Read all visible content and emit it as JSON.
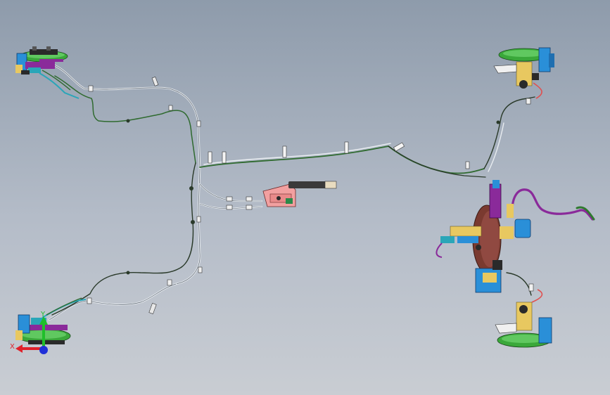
{
  "view": {
    "background_top": "#8e9bab",
    "background_bottom": "#c9cdd3"
  },
  "triad": {
    "x_label": "X",
    "y_label": "Y",
    "x_color": "#e0202a",
    "y_color": "#1fbf2a",
    "z_color": "#2030d8"
  },
  "assemblies": [
    {
      "name": "front-left-brake-corner",
      "part": "brake-disc-caliper"
    },
    {
      "name": "rear-left-brake-corner",
      "part": "brake-disc-caliper"
    },
    {
      "name": "front-right-brake-corner",
      "part": "brake-disc-caliper"
    },
    {
      "name": "rear-right-brake-corner",
      "part": "brake-disc-caliper"
    },
    {
      "name": "master-cylinder-booster",
      "part": "brake-booster"
    },
    {
      "name": "parking-brake-lever",
      "part": "handbrake"
    }
  ],
  "colors": {
    "hard_line": "#e8ecf0",
    "dark_line": "#2a3a2a",
    "green_line": "#2f6a2f",
    "teal_hose": "#2aa6b8",
    "purple_tube": "#8a2a9a",
    "disc_green": "#3aa83a",
    "booster": "#7a3a30",
    "caliper_blue": "#2a8fd8",
    "bracket_yellow": "#e8c860",
    "lever_pink": "#f2a0a0"
  }
}
